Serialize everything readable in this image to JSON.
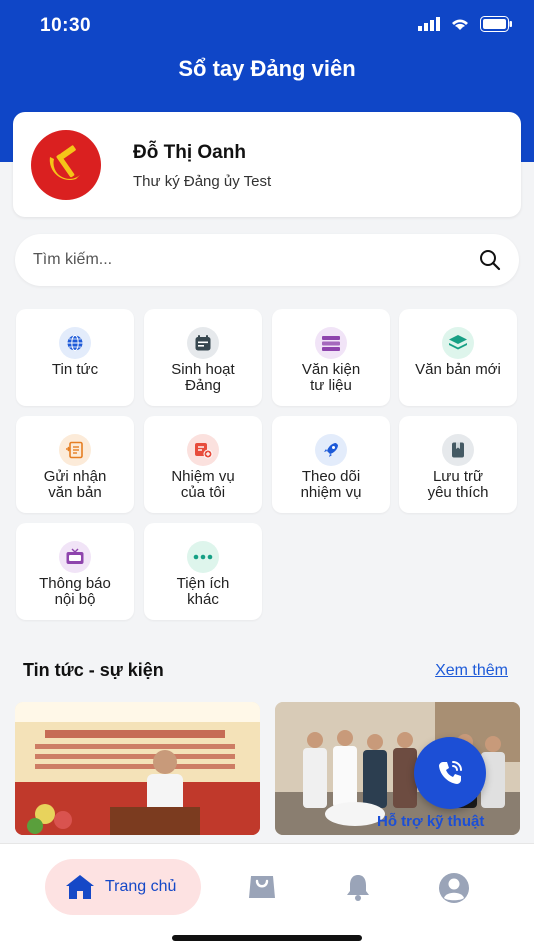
{
  "status_bar": {
    "time": "10:30"
  },
  "header": {
    "title": "Sổ tay Đảng viên"
  },
  "profile": {
    "name": "Đỗ Thị Oanh",
    "role": "Thư ký Đảng ủy Test"
  },
  "search": {
    "placeholder": "Tìm kiếm..."
  },
  "tiles": [
    {
      "label": "Tin tức",
      "icon": "globe-icon",
      "color": "#1d5ad8"
    },
    {
      "label": "Sinh hoạt\nĐảng",
      "icon": "calendar-icon",
      "color": "#37474f"
    },
    {
      "label": "Văn kiện\ntư liệu",
      "icon": "stack-icon",
      "color": "#8e44ad"
    },
    {
      "label": "Văn bản mới",
      "icon": "layers-icon",
      "color": "#16a085"
    },
    {
      "label": "Gửi nhận\nvăn bản",
      "icon": "document-send-icon",
      "color": "#e67e22"
    },
    {
      "label": "Nhiệm vụ\ncủa tôi",
      "icon": "task-add-icon",
      "color": "#e74c3c"
    },
    {
      "label": "Theo dõi\nnhiệm vụ",
      "icon": "rocket-icon",
      "color": "#1d5ad8"
    },
    {
      "label": "Lưu trữ\nyêu thích",
      "icon": "bookmark-icon",
      "color": "#455a64"
    },
    {
      "label": "Thông báo\nnội bộ",
      "icon": "tv-icon",
      "color": "#8e44ad"
    },
    {
      "label": "Tiện ích\nkhác",
      "icon": "more-dots-icon",
      "color": "#16a085"
    }
  ],
  "news_section": {
    "title": "Tin tức - sự kiện",
    "see_more": "Xem thêm"
  },
  "support": {
    "label": "Hỗ trợ kỹ thuật"
  },
  "tabbar": {
    "home_label": "Trang chủ"
  },
  "colors": {
    "primary": "#0f46c7",
    "accent_pink": "#fde2e2",
    "party_red": "#da2020"
  }
}
